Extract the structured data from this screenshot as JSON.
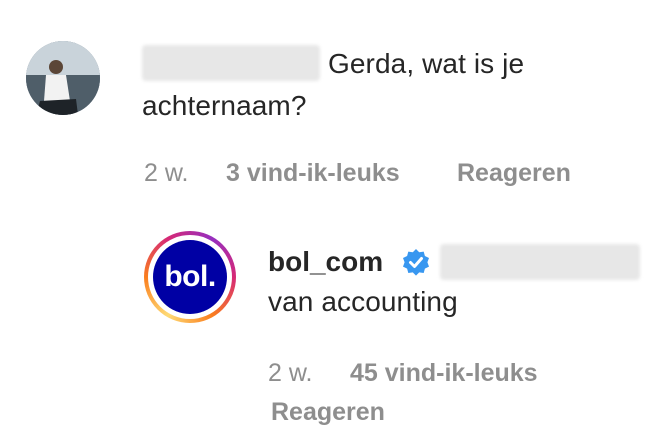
{
  "comment": {
    "text_line1": "Gerda, wat is je",
    "text_line2": "achternaam?",
    "time": "2 w.",
    "likes": "3 vind-ik-leuks",
    "reply_label": "Reageren"
  },
  "reply": {
    "username": "bol_com",
    "avatar_text": "bol.",
    "text": "van accounting",
    "time": "2 w.",
    "likes": "45 vind-ik-leuks",
    "reply_label": "Reageren"
  },
  "colors": {
    "text": "#262626",
    "meta": "#8e8e8e",
    "verified": "#3897f0",
    "bol_brand": "#0000a4"
  },
  "icons": {
    "verified": "verified-badge-icon"
  }
}
